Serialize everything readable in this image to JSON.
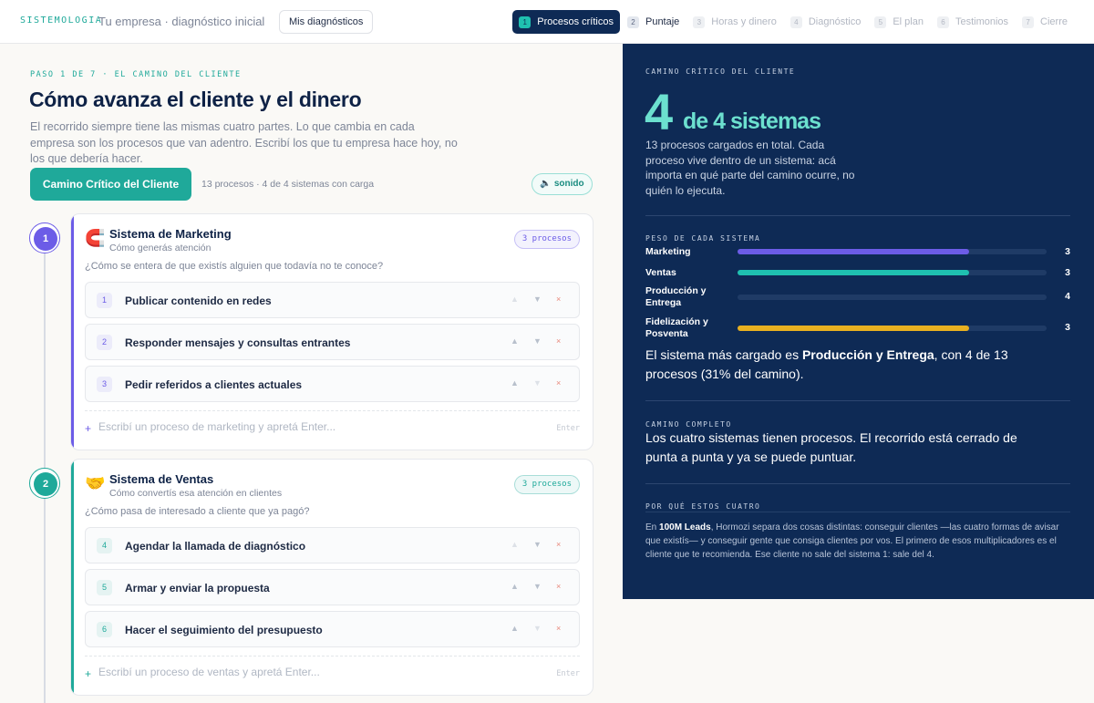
{
  "header": {
    "brand": "SISTEMOLOGIA",
    "company": "Tu empresa · diagnóstico inicial",
    "my_diagnostics": "Mis diagnósticos",
    "steps": [
      {
        "n": "1",
        "label": "Procesos críticos",
        "state": "active"
      },
      {
        "n": "2",
        "label": "Puntaje",
        "state": "done"
      },
      {
        "n": "3",
        "label": "Horas y dinero",
        "state": "pending"
      },
      {
        "n": "4",
        "label": "Diagnóstico",
        "state": "pending"
      },
      {
        "n": "5",
        "label": "El plan",
        "state": "pending"
      },
      {
        "n": "6",
        "label": "Testimonios",
        "state": "pending"
      },
      {
        "n": "7",
        "label": "Cierre",
        "state": "pending"
      }
    ]
  },
  "main": {
    "kicker": "PASO 1 DE 7 · EL CAMINO DEL CLIENTE",
    "title": "Cómo avanza el cliente y el dinero",
    "intro": "El recorrido siempre tiene las mismas cuatro partes. Lo que cambia en cada empresa son los procesos que van adentro. Escribí los que tu empresa hace hoy, no los que debería hacer.",
    "cta": "Camino Crítico del Cliente",
    "summary": "13 procesos · 4 de 4 sistemas con carga",
    "sound_icon": "speaker-icon",
    "sound_label": "sonido",
    "systems": [
      {
        "n": "1",
        "icon": "magnet-icon",
        "emoji": "🧲",
        "title": "Sistema de Marketing",
        "subtitle": "Cómo generás atención",
        "badge": "3 procesos",
        "question": "¿Cómo se entera de que existís alguien que todavía no te conoce?",
        "color": "#6c5ce7",
        "processes": [
          {
            "n": "1",
            "name": "Publicar contenido en redes"
          },
          {
            "n": "2",
            "name": "Responder mensajes y consultas entrantes"
          },
          {
            "n": "3",
            "name": "Pedir referidos a clientes actuales"
          }
        ],
        "add_placeholder": "Escribí un proceso de marketing y apretá Enter...",
        "enter_hint": "Enter"
      },
      {
        "n": "2",
        "icon": "handshake-icon",
        "emoji": "🤝",
        "title": "Sistema de Ventas",
        "subtitle": "Cómo convertís esa atención en clientes",
        "badge": "3 procesos",
        "question": "¿Cómo pasa de interesado a cliente que ya pagó?",
        "color": "#1fa99a",
        "processes": [
          {
            "n": "4",
            "name": "Agendar la llamada de diagnóstico"
          },
          {
            "n": "5",
            "name": "Armar y enviar la propuesta"
          },
          {
            "n": "6",
            "name": "Hacer el seguimiento del presupuesto"
          }
        ],
        "add_placeholder": "Escribí un proceso de ventas y apretá Enter...",
        "enter_hint": "Enter"
      }
    ],
    "controls": {
      "up": "▲",
      "down": "▼",
      "remove": "×"
    }
  },
  "panel": {
    "label_critical": "CAMINO CRÍTICO DEL CLIENTE",
    "big_number": "4",
    "big_suffix": "de 4 sistemas",
    "description": "13 procesos cargados en total. Cada proceso vive dentro de un sistema: acá importa en qué parte del camino ocurre, no quién lo ejecuta.",
    "label_weight": "PESO DE CADA SISTEMA",
    "weights": [
      {
        "name": "Marketing",
        "value": 3,
        "fraction": 0.75,
        "color": "#6c5ce7"
      },
      {
        "name": "Ventas",
        "value": 3,
        "fraction": 0.75,
        "color": "#1fc0b0"
      },
      {
        "name": "Producción y Entrega",
        "value": 4,
        "fraction": 0,
        "color": "#1f3b66"
      },
      {
        "name": "Fidelización y Posventa",
        "value": 3,
        "fraction": 0.75,
        "color": "#e8b020"
      }
    ],
    "heaviest_prefix": "El sistema más cargado es ",
    "heaviest_name": "Producción y Entrega",
    "heaviest_suffix": ", con 4 de 13 procesos (31% del camino).",
    "label_complete": "CAMINO COMPLETO",
    "complete_text": "Los cuatro sistemas tienen procesos. El recorrido está cerrado de punta a punta y ya se puede puntuar.",
    "label_why": "POR QUÉ ESTOS CUATRO",
    "why_prefix": "En ",
    "why_bold": "100M Leads",
    "why_text": ", Hormozi separa dos cosas distintas: conseguir clientes —las cuatro formas de avisar que existís— y conseguir gente que consiga clientes por vos. El primero de esos multiplicadores es el cliente que te recomienda. Ese cliente no sale del sistema 1: sale del 4."
  }
}
